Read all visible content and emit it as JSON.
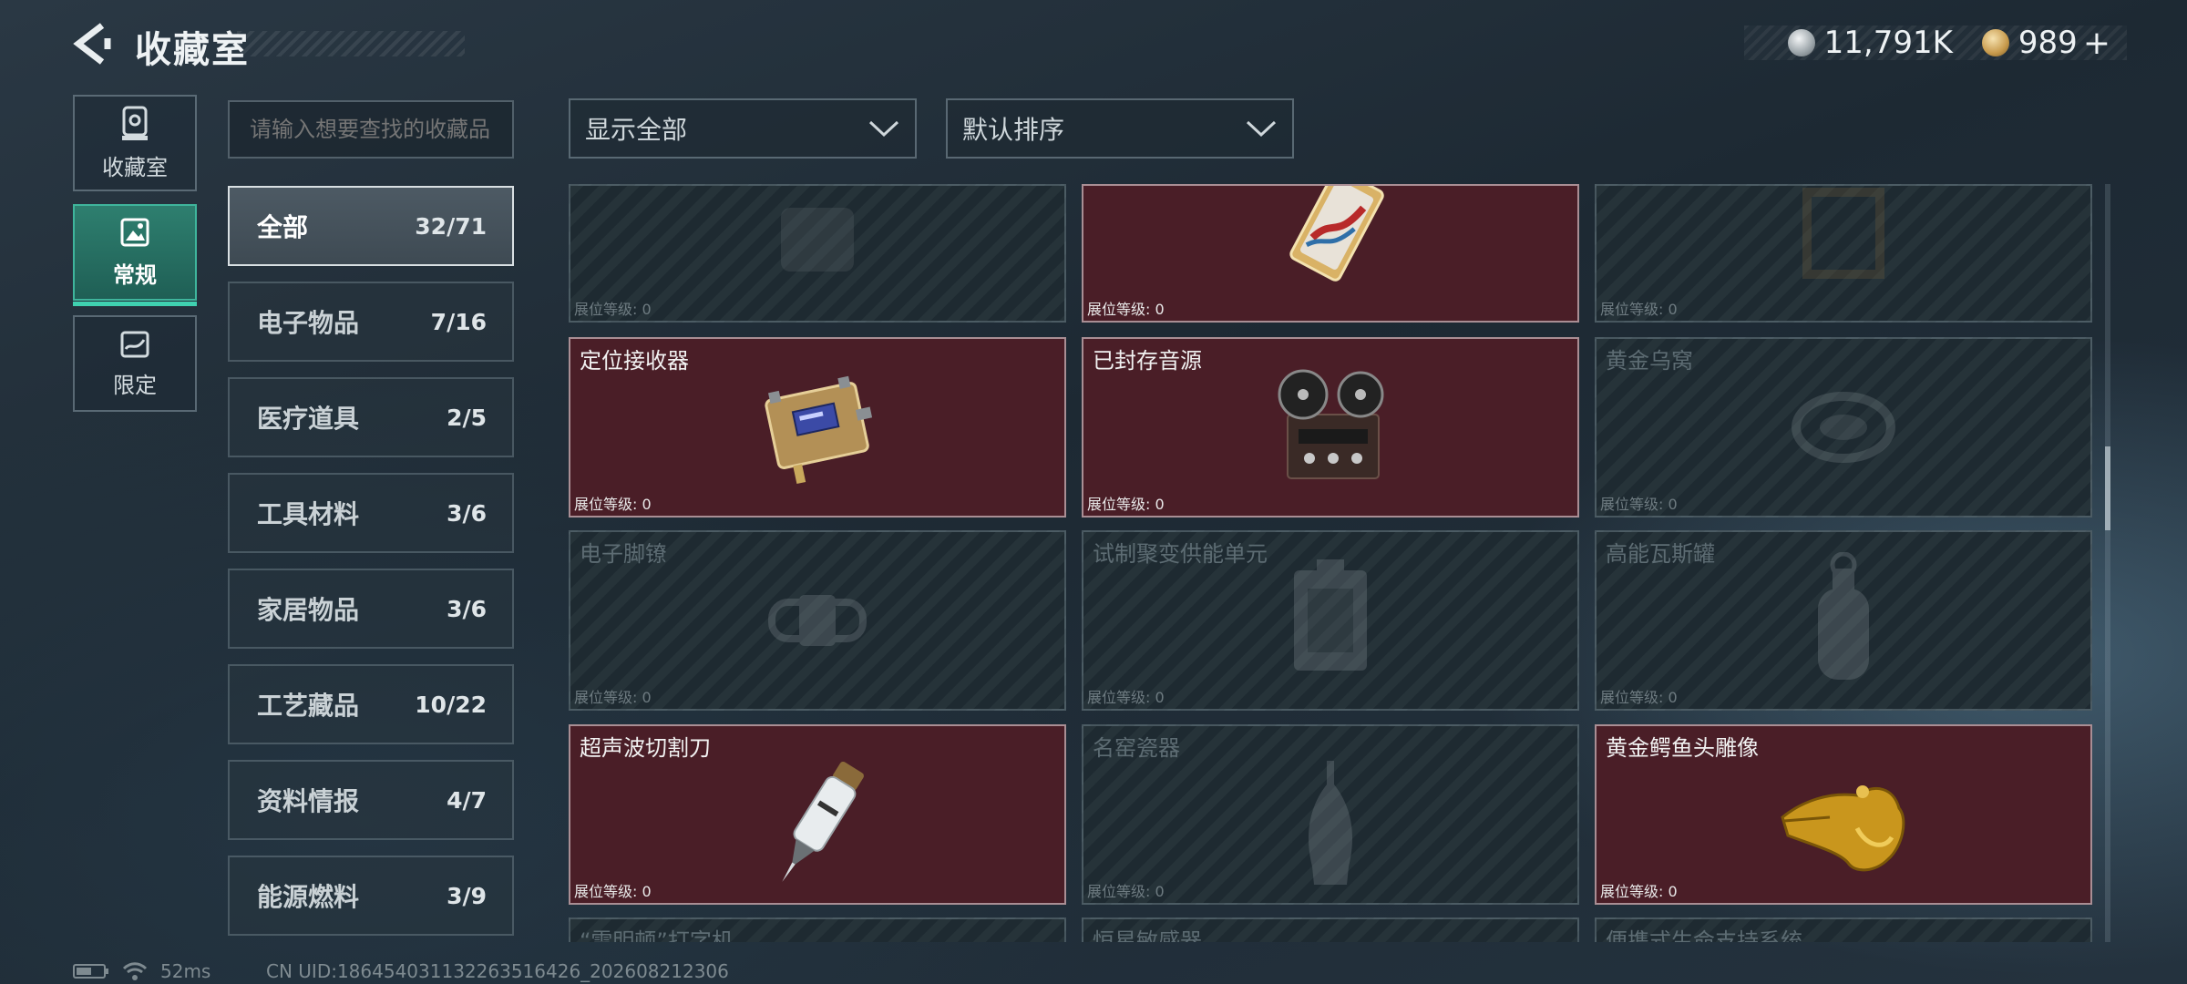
{
  "header": {
    "title": "收藏室"
  },
  "currency": [
    {
      "icon": "silver-coin-icon",
      "value": "11,791K"
    },
    {
      "icon": "gold-coin-icon",
      "value": "989",
      "add_label": "+"
    }
  ],
  "nav": [
    {
      "label": "收藏室",
      "icon": "trophy-case-icon",
      "active": false
    },
    {
      "label": "常规",
      "icon": "picture-icon",
      "active": true
    },
    {
      "label": "限定",
      "icon": "map-scroll-icon",
      "active": false
    }
  ],
  "search": {
    "placeholder": "请输入想要查找的收藏品"
  },
  "categories": [
    {
      "name": "全部",
      "count": "32/71",
      "active": true
    },
    {
      "name": "电子物品",
      "count": "7/16"
    },
    {
      "name": "医疗道具",
      "count": "2/5"
    },
    {
      "name": "工具材料",
      "count": "3/6"
    },
    {
      "name": "家居物品",
      "count": "3/6"
    },
    {
      "name": "工艺藏品",
      "count": "10/22"
    },
    {
      "name": "资料情报",
      "count": "4/7"
    },
    {
      "name": "能源燃料",
      "count": "3/9"
    }
  ],
  "filters": {
    "display": "显示全部",
    "sort": "默认排序"
  },
  "level_label": "展位等级: 0",
  "items": [
    {
      "name": "",
      "owned": false,
      "icon": "device-icon"
    },
    {
      "name": "",
      "owned": true,
      "icon": "ornate-card-icon"
    },
    {
      "name": "",
      "owned": false,
      "icon": "frame-icon"
    },
    {
      "name": "定位接收器",
      "owned": true,
      "icon": "receiver-icon"
    },
    {
      "name": "已封存音源",
      "owned": true,
      "icon": "reel-tape-icon"
    },
    {
      "name": "黄金乌窝",
      "owned": false,
      "icon": "nest-icon"
    },
    {
      "name": "电子脚镣",
      "owned": false,
      "icon": "ankle-monitor-icon"
    },
    {
      "name": "试制聚变供能单元",
      "owned": false,
      "icon": "fusion-unit-icon"
    },
    {
      "name": "高能瓦斯罐",
      "owned": false,
      "icon": "gas-tank-icon"
    },
    {
      "name": "超声波切割刀",
      "owned": true,
      "icon": "cutter-icon"
    },
    {
      "name": "名窑瓷器",
      "owned": false,
      "icon": "vase-icon"
    },
    {
      "name": "黄金鳄鱼头雕像",
      "owned": true,
      "icon": "crocodile-statue-icon"
    },
    {
      "name": "“雷明顿”打字机",
      "owned": false,
      "icon": "typewriter-icon"
    },
    {
      "name": "恒星敏感器",
      "owned": false,
      "icon": "star-sensor-icon"
    },
    {
      "name": "便携式生命支持系统",
      "owned": false,
      "icon": "life-support-icon"
    }
  ],
  "status": {
    "ping": "52ms",
    "uid": "CN UID:18645403113226351642​6_202608212306"
  }
}
